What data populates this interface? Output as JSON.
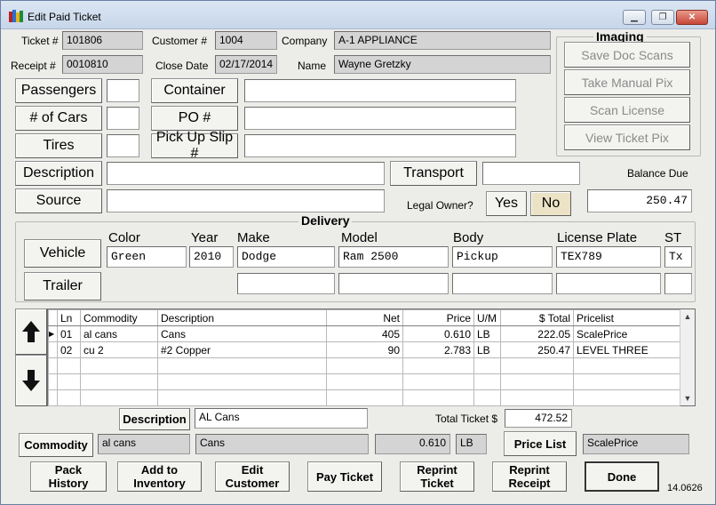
{
  "window": {
    "title": "Edit Paid Ticket"
  },
  "ticket": {
    "ticket_label": "Ticket #",
    "ticket_value": "101806",
    "customer_label": "Customer #",
    "customer_value": "1004",
    "company_label": "Company",
    "company_value": "A-1 APPLIANCE",
    "receipt_label": "Receipt #",
    "receipt_value": "0010810",
    "close_date_label": "Close Date",
    "close_date_value": "02/17/2014",
    "name_label": "Name",
    "name_value": "Wayne Gretzky"
  },
  "imaging": {
    "title": "Imaging",
    "buttons": [
      "Save Doc Scans",
      "Take Manual Pix",
      "Scan License",
      "View Ticket Pix"
    ]
  },
  "left_buttons": {
    "passengers": "Passengers",
    "cars": "# of Cars",
    "tires": "Tires",
    "container": "Container",
    "po": "PO #",
    "pickup": "Pick Up Slip #",
    "description": "Description",
    "source": "Source",
    "transport": "Transport"
  },
  "balance": {
    "label": "Balance Due",
    "value": "250.47"
  },
  "legal_owner": {
    "label": "Legal Owner?",
    "yes": "Yes",
    "no": "No"
  },
  "delivery": {
    "title": "Delivery",
    "vehicle_button": "Vehicle",
    "trailer_button": "Trailer",
    "headers": {
      "color": "Color",
      "year": "Year",
      "make": "Make",
      "model": "Model",
      "body": "Body",
      "plate": "License Plate",
      "state": "ST"
    },
    "vehicle": {
      "color": "Green",
      "year": "2010",
      "make": "Dodge",
      "model": "Ram 2500",
      "body": "Pickup",
      "plate": "TEX789",
      "state": "Tx"
    }
  },
  "grid": {
    "columns": [
      "Ln",
      "Commodity",
      "Description",
      "Net",
      "Price",
      "U/M",
      "$ Total",
      "Pricelist"
    ],
    "rows": [
      [
        "01",
        "al cans",
        "Cans",
        "405",
        "0.610",
        "LB",
        "222.05",
        "ScalePrice"
      ],
      [
        "02",
        "cu 2",
        "#2 Copper",
        "90",
        "2.783",
        "LB",
        "250.47",
        "LEVEL THREE"
      ]
    ]
  },
  "line_edit": {
    "description_button": "Description",
    "description_value": "AL Cans",
    "total_label": "Total Ticket $",
    "total_value": "472.52",
    "commodity_button": "Commodity",
    "commodity_code": "al cans",
    "commodity_desc": "Cans",
    "price": "0.610",
    "um": "LB",
    "price_list_button": "Price List",
    "price_list_value": "ScalePrice"
  },
  "bottom_buttons": {
    "pack_history": "Pack\nHistory",
    "add_inventory": "Add to\nInventory",
    "edit_customer": "Edit\nCustomer",
    "pay_ticket": "Pay Ticket",
    "reprint_ticket": "Reprint\nTicket",
    "reprint_receipt": "Reprint\nReceipt",
    "done": "Done"
  },
  "version": "14.0626"
}
